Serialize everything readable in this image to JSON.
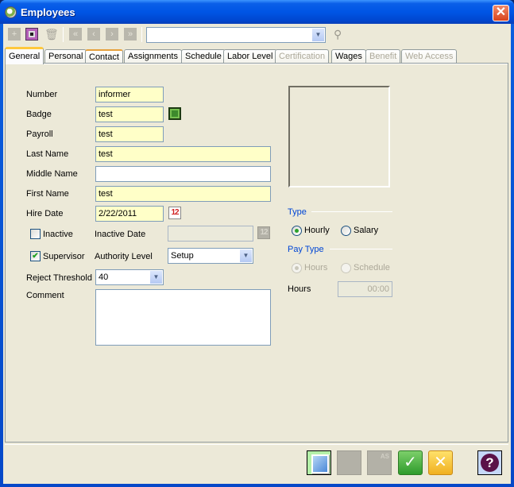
{
  "window": {
    "title": "Employees",
    "close_icon": "close-icon",
    "app_icon": "clock-icon"
  },
  "toolbar": {
    "add_icon": "plus-icon",
    "save_icon": "floppy-disk-icon",
    "delete_icon": "trash-icon",
    "first_icon": "first-record-icon",
    "prev_icon": "previous-record-icon",
    "next_icon": "next-record-icon",
    "last_icon": "last-record-icon",
    "search_combo_value": "",
    "find_icon": "binoculars-icon"
  },
  "tabs": [
    {
      "label": "General",
      "state": "active"
    },
    {
      "label": "Personal",
      "state": "enabled"
    },
    {
      "label": "Contact",
      "state": "hot"
    },
    {
      "label": "Assignments",
      "state": "enabled"
    },
    {
      "label": "Schedule",
      "state": "enabled"
    },
    {
      "label": "Labor Level",
      "state": "enabled"
    },
    {
      "label": "Certification",
      "state": "disabled"
    },
    {
      "label": "Wages",
      "state": "enabled"
    },
    {
      "label": "Benefit",
      "state": "disabled"
    },
    {
      "label": "Web Access",
      "state": "disabled"
    }
  ],
  "form": {
    "number": {
      "label": "Number",
      "value": "informer"
    },
    "badge": {
      "label": "Badge",
      "value": "test"
    },
    "payroll": {
      "label": "Payroll",
      "value": "test"
    },
    "last_name": {
      "label": "Last Name",
      "value": "test"
    },
    "middle_name": {
      "label": "Middle Name",
      "value": ""
    },
    "first_name": {
      "label": "First Name",
      "value": "test"
    },
    "hire_date": {
      "label": "Hire Date",
      "value": "2/22/2011"
    },
    "inactive": {
      "label": "Inactive",
      "checked": false
    },
    "inactive_date": {
      "label": "Inactive Date",
      "value": ""
    },
    "supervisor": {
      "label": "Supervisor",
      "checked": true,
      "check_glyph": "✔"
    },
    "authority_level": {
      "label": "Authority Level",
      "value": "Setup"
    },
    "reject_threshold": {
      "label": "Reject Threshold",
      "value": "40"
    },
    "comment": {
      "label": "Comment",
      "value": ""
    },
    "calendar_glyph": "12"
  },
  "type_group": {
    "title": "Type",
    "options": [
      {
        "label": "Hourly",
        "checked": true
      },
      {
        "label": "Salary",
        "checked": false
      }
    ]
  },
  "pay_type_group": {
    "title": "Pay Type",
    "options": [
      {
        "label": "Hours",
        "checked": true,
        "enabled": false
      },
      {
        "label": "Schedule",
        "checked": false,
        "enabled": false
      }
    ],
    "hours_label": "Hours",
    "hours_value": "00:00"
  },
  "footer": {
    "photo_icon": "photo-icon",
    "report_icon": "report-icon",
    "save_as_label": "AS",
    "ok_glyph": "✓",
    "cancel_glyph": "✕",
    "help_icon": "help-icon"
  }
}
